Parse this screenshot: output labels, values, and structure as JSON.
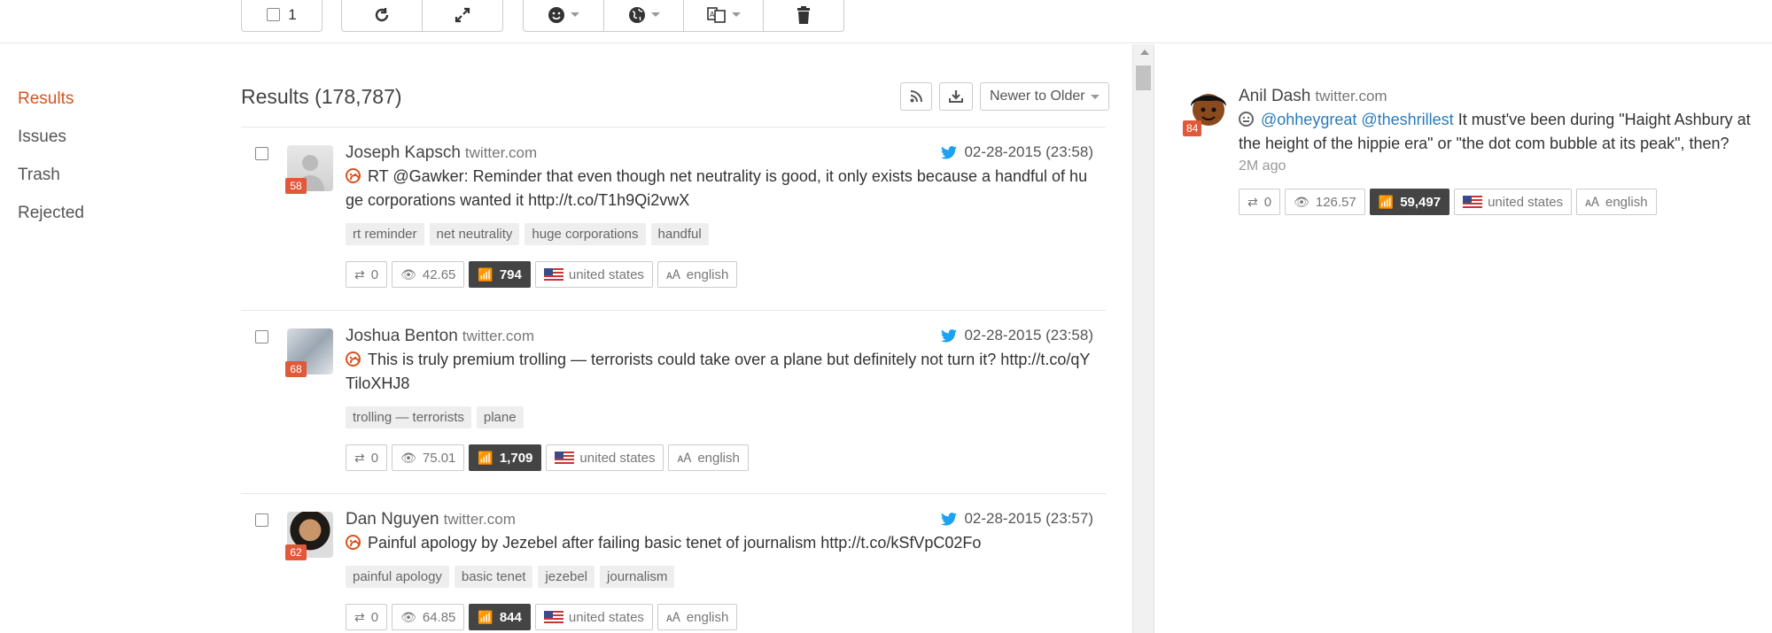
{
  "toolbar": {
    "select_count": "1"
  },
  "sidebar": {
    "items": [
      {
        "label": "Results",
        "active": true
      },
      {
        "label": "Issues"
      },
      {
        "label": "Trash"
      },
      {
        "label": "Rejected"
      }
    ]
  },
  "results": {
    "title": "Results (178,787)",
    "sort_label": "Newer to Older"
  },
  "posts": [
    {
      "author": "Joseph Kapsch",
      "source": "twitter.com",
      "date": "02-28-2015 (23:58)",
      "score": "58",
      "text": "RT @Gawker: Reminder that even though net neutrality is good, it only exists because a handful of huge corporations wanted it http://t.co/T1h9Qi2vwX",
      "tags": [
        "rt reminder",
        "net neutrality",
        "huge corporations",
        "handful"
      ],
      "retweets": "0",
      "views": "42.65",
      "reach": "794",
      "country": "united states",
      "language": "english"
    },
    {
      "author": "Joshua Benton",
      "source": "twitter.com",
      "date": "02-28-2015 (23:58)",
      "score": "68",
      "text": "This is truly premium trolling — terrorists could take over a plane but definitely not turn it? http://t.co/qYTiloXHJ8",
      "tags": [
        "trolling — terrorists",
        "plane"
      ],
      "retweets": "0",
      "views": "75.01",
      "reach": "1,709",
      "country": "united states",
      "language": "english"
    },
    {
      "author": "Dan Nguyen",
      "source": "twitter.com",
      "date": "02-28-2015 (23:57)",
      "score": "62",
      "text": "Painful apology by Jezebel after failing basic tenet of journalism http://t.co/kSfVpC02Fo",
      "tags": [
        "painful apology",
        "basic tenet",
        "jezebel",
        "journalism"
      ],
      "retweets": "0",
      "views": "64.85",
      "reach": "844",
      "country": "united states",
      "language": "english"
    }
  ],
  "detail": {
    "author": "Anil Dash",
    "source": "twitter.com",
    "score": "84",
    "mention1": "@ohheygreat",
    "mention2": "@theshrillest",
    "text": "It must've been during \"Haight Ashbury at the height of the hippie era\" or \"the dot com bubble at its peak\", then?",
    "time": "2M ago",
    "retweets": "0",
    "views": "126.57",
    "reach": "59,497",
    "country": "united states",
    "language": "english"
  },
  "colors": {
    "accent": "#d9531e",
    "link": "#2a7ab9",
    "dark_badge": "#444444",
    "twitter": "#1da1f2"
  }
}
